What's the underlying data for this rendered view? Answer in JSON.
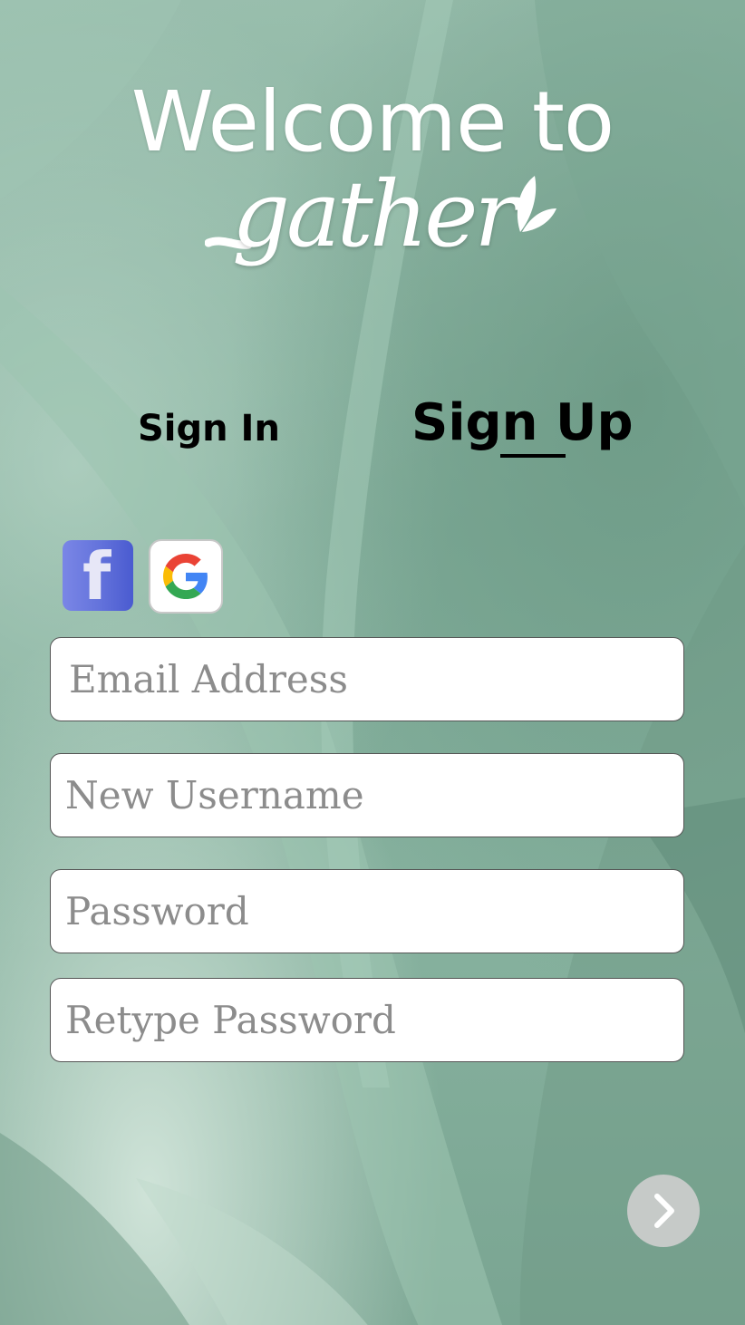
{
  "header": {
    "welcome_text": "Welcome to",
    "logo_text": "gather"
  },
  "tabs": {
    "sign_in": "Sign In",
    "sign_up": "Sign Up",
    "active": "Sign Up"
  },
  "social": {
    "facebook_letter": "f",
    "facebook_icon": "facebook-icon",
    "google_icon": "google-icon"
  },
  "form": {
    "email_placeholder": "Email Address",
    "username_placeholder": "New Username",
    "password_placeholder": "Password",
    "retype_placeholder": "Retype Password"
  },
  "next_button": {
    "icon": "chevron-right-icon"
  },
  "colors": {
    "background": "#86b19e",
    "text_primary": "#000000",
    "text_light": "#ffffff",
    "facebook": "#5b6bd8",
    "field_placeholder": "#8c8c8c",
    "next_button_bg": "#cdcdcd"
  }
}
